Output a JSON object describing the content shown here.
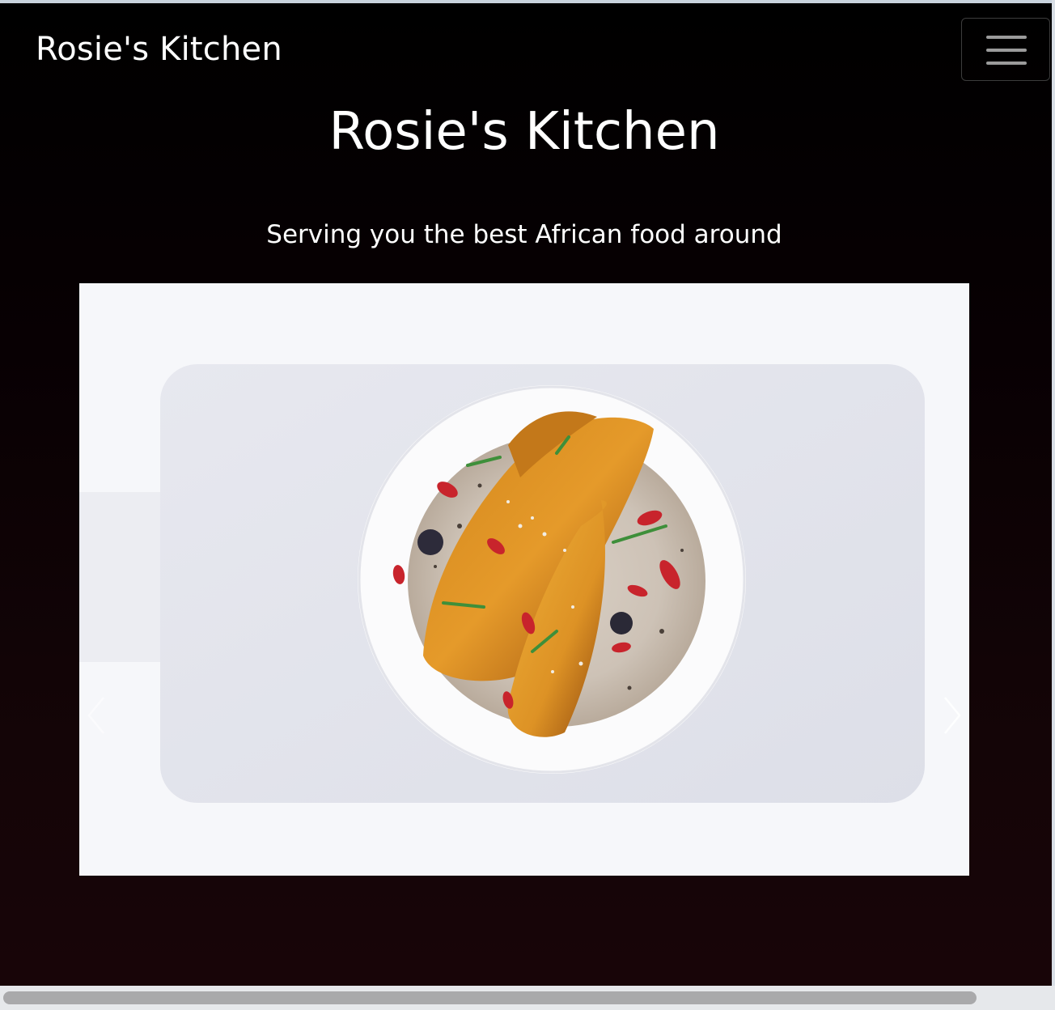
{
  "navbar": {
    "brand": "Rosie's Kitchen",
    "toggler_icon": "hamburger-menu-icon"
  },
  "hero": {
    "title": "Rosie's Kitchen",
    "subtitle": "Serving you the best African food around"
  },
  "carousel": {
    "slide_image": "plantain-porridge-bowl-photo",
    "prev_icon": "chevron-left-icon",
    "next_icon": "chevron-right-icon"
  },
  "colors": {
    "background_top": "#000000",
    "background_bottom": "#180508",
    "text": "#ffffff"
  }
}
